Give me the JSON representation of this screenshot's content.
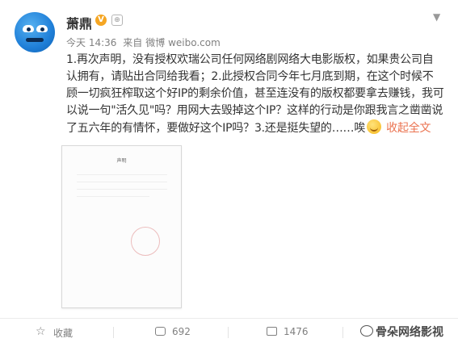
{
  "user": {
    "name": "萧鼎",
    "verified_badge": "V",
    "level_badge": "⊕",
    "dropdown_icon": "chevron-down-icon"
  },
  "meta": {
    "time": "今天 14:36",
    "source_prefix": "来自",
    "source": "微博 weibo.com"
  },
  "post": {
    "text": "1.再次声明，没有授权欢瑞公司任何网络剧网络大电影版权，如果贵公司自认拥有，请贴出合同给我看；2.此授权合同今年七月底到期，在这个时候不顾一切疯狂榨取这个好IP的剩余价值，甚至连没有的版权都要拿去赚钱，我可以说一句\"活久见\"吗？用网大去毁掉这个IP？这样的行动是你跟我言之凿凿说了五六年的有情怀，要做好这个IP吗？3.还是挺失望的……唉",
    "collapse_label": "收起全文"
  },
  "document_image": {
    "title": "声明"
  },
  "toolbar": {
    "favorite_label": "收藏",
    "repost_count": "692",
    "comment_count": "1476"
  },
  "watermark": {
    "text": "骨朵网络影视"
  }
}
